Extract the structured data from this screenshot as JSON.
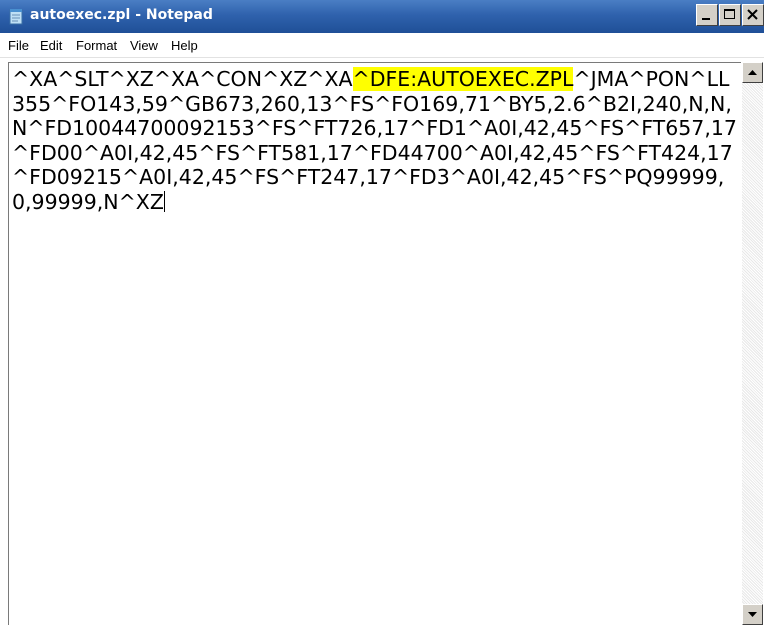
{
  "window": {
    "title": "autoexec.zpl - Notepad",
    "icon": "notepad-icon",
    "buttons": [
      "minimize-icon",
      "maximize-icon",
      "close-icon"
    ]
  },
  "menu": {
    "items": [
      "File",
      "Edit",
      "Format",
      "View",
      "Help"
    ]
  },
  "editor": {
    "text_before": "^XA^SLT^XZ^XA^CON^XZ^XA",
    "text_highlighted": "^DFE:AUTOEXEC.ZPL",
    "text_after": "^JMA^PON^LL355^FO143,59^GB673,260,13^FS^FO169,71^BY5,2.6^B2I,240,N,N,N^FD10044700092153^FS^FT726,17^FD1^A0I,42,45^FS^FT657,17^FD00^A0I,42,45^FS^FT581,17^FD44700^A0I,42,45^FS^FT424,17^FD09215^A0I,42,45^FS^FT247,17^FD3^A0I,42,45^FS^PQ99999,0,99999,N^XZ",
    "highlight_color": "#ffff00"
  },
  "scrollbar": {
    "up_icon": "scroll-up-arrow-icon",
    "down_icon": "scroll-down-arrow-icon"
  }
}
